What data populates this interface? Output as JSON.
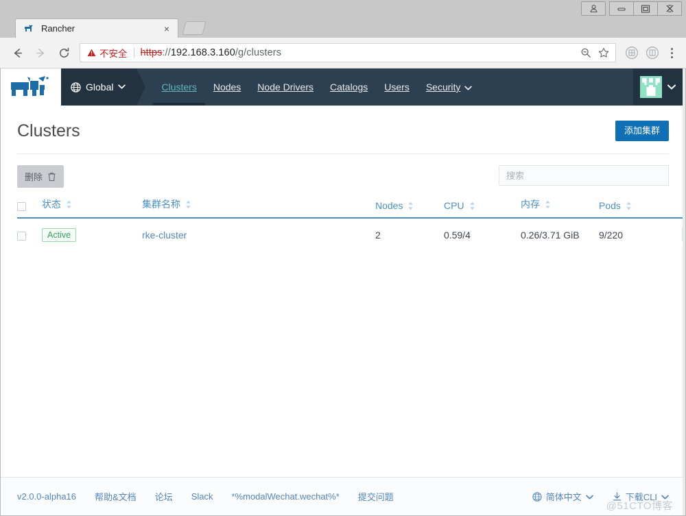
{
  "browser": {
    "tab": {
      "title": "Rancher",
      "favicon": "rancher-cow-favicon",
      "close_label": "×"
    },
    "new_tab_label": "",
    "window_controls": {
      "user": "user-icon",
      "minimize": "minimize-icon",
      "maximize": "maximize-icon",
      "close": "close-icon"
    },
    "nav": {
      "back": "back-arrow-icon",
      "forward": "forward-arrow-icon",
      "reload": "reload-icon"
    },
    "omnibox": {
      "security_label": "不安全",
      "security_icon": "warning-triangle-icon",
      "scheme": "https",
      "scheme_sep": "://",
      "host": "192.168.3.160",
      "path": "/g/clusters",
      "zoom_icon": "zoom-out-icon",
      "bookmark_icon": "star-icon"
    },
    "extensions": [
      "extension-icon-1",
      "extension-icon-2"
    ],
    "menu_icon": "three-dot-menu-icon"
  },
  "rancher": {
    "logo": "rancher-cow-logo",
    "context": {
      "label": "Global",
      "icon": "globe-icon",
      "chevron": "⌄"
    },
    "nav_items": [
      {
        "label": "Clusters",
        "active": true,
        "has_chevron": false
      },
      {
        "label": "Nodes",
        "active": false,
        "has_chevron": false
      },
      {
        "label": "Node Drivers",
        "active": false,
        "has_chevron": false
      },
      {
        "label": "Catalogs",
        "active": false,
        "has_chevron": false
      },
      {
        "label": "Users",
        "active": false,
        "has_chevron": false
      },
      {
        "label": "Security",
        "active": false,
        "has_chevron": true
      }
    ],
    "avatar": {
      "name": "user-avatar",
      "chevron": "⌄"
    },
    "page_title": "Clusters",
    "add_button": "添加集群",
    "toolbar": {
      "delete_label": "删除",
      "delete_icon": "trash-icon"
    },
    "search": {
      "placeholder": "搜索",
      "value": ""
    },
    "table": {
      "columns": [
        {
          "key": "checkbox",
          "label": "",
          "sortable": false
        },
        {
          "key": "state",
          "label": "状态",
          "sortable": true
        },
        {
          "key": "name",
          "label": "集群名称",
          "sortable": true
        },
        {
          "key": "nodes",
          "label": "Nodes",
          "sortable": true
        },
        {
          "key": "cpu",
          "label": "CPU",
          "sortable": true
        },
        {
          "key": "memory",
          "label": "内存",
          "sortable": true
        },
        {
          "key": "pods",
          "label": "Pods",
          "sortable": true
        },
        {
          "key": "actions",
          "label": "",
          "sortable": false
        }
      ],
      "rows": [
        {
          "state": "Active",
          "name": "rke-cluster",
          "nodes": "2",
          "cpu": "0.59/4",
          "memory": "0.26/3.71 GiB",
          "pods": "9/220"
        }
      ]
    },
    "footer": {
      "links": [
        "v2.0.0-alpha16",
        "帮助&文档",
        "论坛",
        "Slack",
        "*%modalWechat.wechat%*",
        "提交问题"
      ],
      "language": {
        "label": "简体中文",
        "icon": "globe-icon",
        "chevron": "⌄"
      },
      "cli": {
        "label": "下载CLI",
        "icon": "download-icon",
        "chevron": "⌄"
      }
    },
    "watermark": "@51CTO博客"
  },
  "colors": {
    "nav_bg": "#2d4051",
    "nav_dark": "#233240",
    "accent_teal": "#64b5bd",
    "primary_blue": "#0f70b5",
    "link_blue": "#5286bd",
    "header_blue": "#4a90c4",
    "active_green": "#3d9e5a",
    "insecure_red": "#c5221f"
  }
}
